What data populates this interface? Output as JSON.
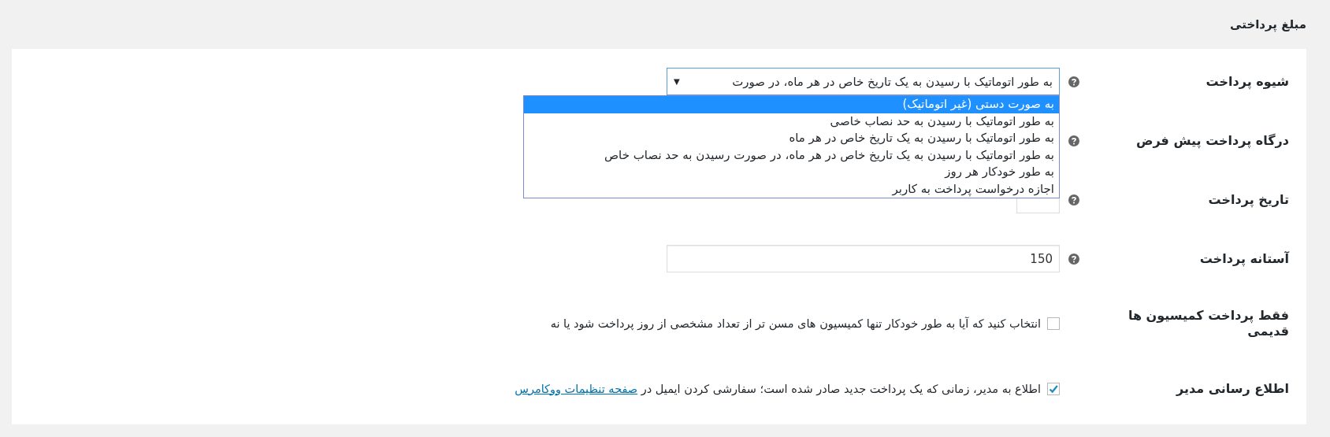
{
  "section_title": "مبلغ پرداختی",
  "rows": [
    {
      "kind": "select",
      "label": "شیوه پرداخت",
      "value": "به طور اتوماتیک با رسیدن به یک تاریخ خاص در هر ماه، در صورت",
      "caret": "▼",
      "options": [
        {
          "label": "به صورت دستی (غیر اتوماتیک)",
          "selected": true
        },
        {
          "label": "به طور اتوماتیک با رسیدن به حد نصاب خاصی",
          "selected": false
        },
        {
          "label": "به طور اتوماتیک با رسیدن به یک تاریخ خاص در هر ماه",
          "selected": false
        },
        {
          "label": "به طور اتوماتیک با رسیدن به یک تاریخ خاص در هر ماه، در صورت رسیدن به حد نصاب خاص",
          "selected": false
        },
        {
          "label": "به طور خودکار هر روز",
          "selected": false
        },
        {
          "label": "اجازه درخواست پرداخت به کاربر",
          "selected": false
        }
      ]
    },
    {
      "kind": "hidden",
      "label": "درگاه پرداخت پیش فرض"
    },
    {
      "kind": "number",
      "label": "تاریخ پرداخت"
    },
    {
      "kind": "text",
      "label": "آستانه پرداخت",
      "value": "150"
    },
    {
      "kind": "checkbox",
      "label": "فقط پرداخت کمیسیون ها قدیمی",
      "checked": false,
      "description": "انتخاب کنید که آیا به طور خودکار تنها کمیسیون های مسن تر از تعداد مشخصی از روز پرداخت شود یا نه"
    },
    {
      "kind": "checkbox",
      "label": "اطلاع رسانی مدیر",
      "checked": true,
      "description": "اطلاع به مدیر، زمانی که یک پرداخت جدید صادر شده است؛ سفارشی کردن ایمیل در",
      "link": "صفحه تنظیمات ووکامرس"
    }
  ]
}
